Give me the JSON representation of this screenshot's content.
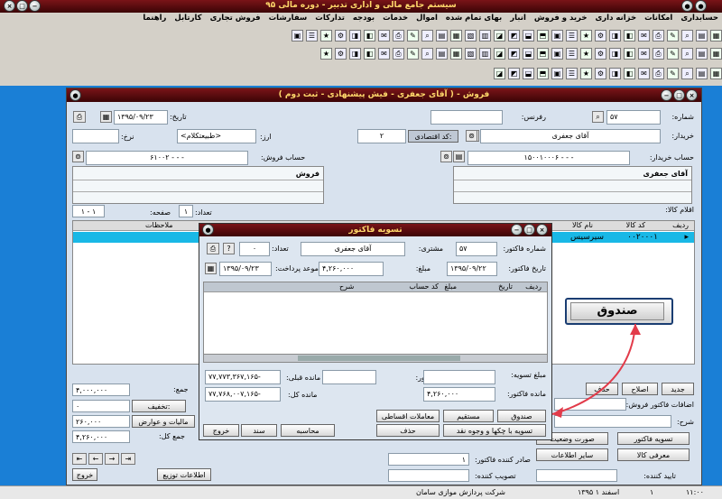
{
  "app": {
    "title": "سیستم جامع مالی و اداری تدبیر - دوره مالی ۹۵"
  },
  "menu": [
    "حسابداری",
    "امکانات",
    "خزانه داری",
    "خرید و فروش",
    "انبار",
    "بهای تمام شده",
    "اموال",
    "خدمات",
    "بودجه",
    "تدارکات",
    "سفارشات",
    "فروش تجاری",
    "کارتابل",
    "راهنما"
  ],
  "sales": {
    "title": "فروش - ( آقای جعفری - فیش پیشنهادی - ثبت دوم )",
    "number_label": "شماره:",
    "number": "۵۷",
    "ref_label": "رفرنس:",
    "date_label": "تاریخ:",
    "date": "۱۳۹۵/۰۹/۲۳",
    "buyer_label": "خریدار:",
    "buyer": "آقای جعفری",
    "econ_label": "کد اقتصادی:",
    "econ_value": "۲",
    "currency_label": "ارز:",
    "currency": "<طبیعتکلام>",
    "rate_label": "نرخ:",
    "buyer_acc_label": "حساب خریدار:",
    "buyer_acc": "۱۵۰۰۱۰۰۰۶ - - -",
    "sales_acc_label": "حساب فروش:",
    "sales_acc": "۶۱۰۰۲ - - -",
    "buyer_name": "آقای جعفری",
    "sales_title": "فروش",
    "items_label": "اقلام کالا:",
    "count_label": "تعداد:",
    "count": "۱",
    "page_label": "صفحه:",
    "page": "۱ - ۱",
    "grid_cols": [
      "ردیف",
      "کد کالا",
      "نام کالا",
      "ملاحظات"
    ],
    "row_code": "۰۰۲۰۰۰۱",
    "row_name": "سیرسیس",
    "new_label": "جدید",
    "edit_label": "اصلاح",
    "del_label": "حذف",
    "sum_label": "جمع:",
    "sum": "۴,۰۰۰,۰۰۰",
    "discount_label": "تخفیف:",
    "discount": "۰",
    "tax_label": "مالیات و عوارض",
    "tax": "۲۶۰,۰۰۰",
    "total_label": "جمع کل:",
    "total": "۴,۲۶۰,۰۰۰",
    "settle_label": "تسویه فاکتور",
    "status_label": "صورت وضعیت",
    "intro_label": "معرفی کالا",
    "other_label": "سایر اطلاعات",
    "dist_label": "اطلاعات توزیع",
    "exit_label": "خروج",
    "issuer_label": "صادر کننده فاکتور:",
    "issuer": "۱",
    "approver_label": "تصویب کننده:",
    "confirmer_label": "تایید کننده:",
    "invoice_label": "اضافات فاکتور فروش:",
    "desc_label": "شرح:"
  },
  "settle": {
    "title": "تسویه فاکتور",
    "inv_no_label": "شماره فاکتور:",
    "inv_no": "۵۷",
    "customer_label": "مشتری:",
    "customer": "آقای جعفری",
    "count_label": "تعداد:",
    "count": "۰",
    "inv_date_label": "تاریخ فاکتور:",
    "inv_date": "۱۳۹۵/۰۹/۲۲",
    "amount_label": "مبلغ:",
    "amount": "۴,۲۶۰,۰۰۰",
    "due_label": "موعد پرداخت:",
    "due": "۱۳۹۵/۰۹/۲۳",
    "cols": [
      "ردیف",
      "تاریخ",
      "مبلغ",
      "کد حساب",
      "شرح"
    ],
    "settle_amt_label": "مبلغ تسویه:",
    "prepay_label": "پیش فاکتور:",
    "prev_label": "مانده قبلی:",
    "prev": "۷۷,۷۷۳,۳۶۷,۱۶۵-",
    "remain_label": "مانده فاکتور:",
    "remain": "۴,۲۶۰,۰۰۰",
    "total_label": "مانده کل:",
    "total": "۷۷,۷۶۸,۰۰۷,۱۶۵-",
    "cash": "صندوق",
    "direct": "مستقیم",
    "credit": "معاملات اقساطی",
    "cheque": "تسویه با چکها و وجوه نقد",
    "delete": "حذف",
    "calc": "محاسبه",
    "doc": "سند",
    "exit": "خروج"
  },
  "callout": {
    "label": "صندوق"
  },
  "status": {
    "company": "شرکت پردازش موازی سامان",
    "date": "۱۳۹۵ اسفند ۱",
    "time": "۱۱:۰۰",
    "page": "۱"
  }
}
